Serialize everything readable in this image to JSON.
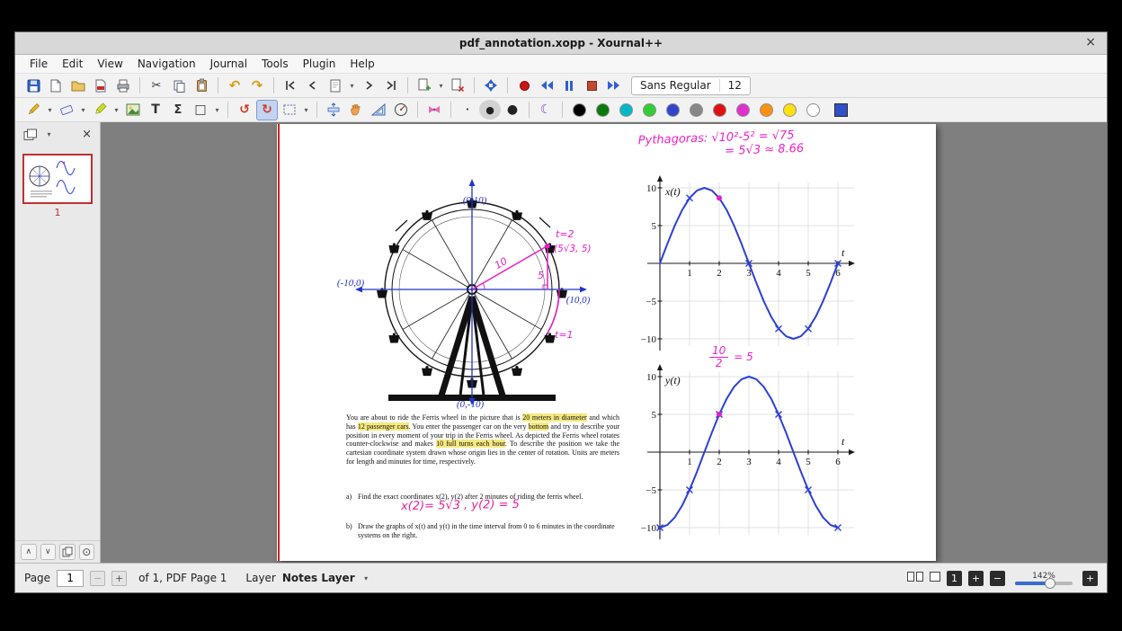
{
  "window": {
    "title": "pdf_annotation.xopp - Xournal++",
    "close": "×"
  },
  "menubar": {
    "items": [
      "File",
      "Edit",
      "View",
      "Navigation",
      "Journal",
      "Tools",
      "Plugin",
      "Help"
    ]
  },
  "toolbar": {
    "font_name": "Sans Regular",
    "font_size": "12",
    "icons": {
      "cut": "✂",
      "undo": "↶",
      "redo": "↷",
      "chevron_down": "▾",
      "text_tool": "T",
      "math_tool": "Σ",
      "shape_tool": "□",
      "default_tool": "↺",
      "shape_recognizer": "↻",
      "moon": "☾",
      "dot_small": "•",
      "dot_medium": "●",
      "dot_large": "●"
    },
    "colors": [
      "#000000",
      "#0a7a0a",
      "#00b8c8",
      "#33cc33",
      "#3344cc",
      "#888888",
      "#e01010",
      "#e030d0",
      "#ff9010",
      "#ffe010",
      "#ffffff"
    ],
    "active_color": "#3050c8"
  },
  "sidebar": {
    "close": "×",
    "thumb_label": "1",
    "nav_up": "∧",
    "nav_down": "∨",
    "target": "⊙"
  },
  "statusbar": {
    "page_label": "Page",
    "page_value": "1",
    "minus": "−",
    "plus": "+",
    "of_text": "of 1, PDF Page 1",
    "layer_label": "Layer",
    "layer_value": "Notes Layer",
    "chevron": "▾",
    "fit_value": "1",
    "zoom_in": "+",
    "zoom_out": "−",
    "zoom_percent": "142%",
    "zoom_add": "+"
  },
  "document": {
    "pythagoras": {
      "line1": "Pythagoras: √10²-5² = √75",
      "line2": "= 5√3 ≈ 8.66"
    },
    "wheel": {
      "label_top": "(0,10)",
      "label_left": "(-10,0)",
      "label_right": "(10,0)",
      "label_bottom": "(0,-10)",
      "t2": "t=2",
      "point": "(5√3, 5)",
      "radius": "10",
      "height": "5",
      "t1": "t=1"
    },
    "paragraph": {
      "seg1": "You are about to ride the Ferris wheel in the picture that is ",
      "hl1": "20 meters in diameter",
      "seg2": " and which has ",
      "hl2": "12 passenger cars",
      "seg3": ".  You enter the passenger car on the very ",
      "hl3": "bottom",
      "seg4": " and try to describe your position in every moment of your trip in the Ferris wheel. As depicted the Ferris wheel rotates counter-clockwise and makes ",
      "hl4": "10 full turns each hour",
      "seg5": ". To describe the position we take the cartesian coordinate system drawn whose origin lies in the center of rotation. Units are meters for length and minutes for time, respectively."
    },
    "item_a_label": "a)",
    "item_a_text": "Find the exact coordinates x(2), y(2) after 2 minutes of riding the ferris wheel.",
    "answer": "x(2)= 5√3 , y(2) = 5",
    "item_b_label": "b)",
    "item_b_text": "Draw the graphs of x(t) and y(t) in the time interval from 0 to 6 minutes in the coordinate systems on the right.",
    "fraction": {
      "num": "10",
      "den": "2",
      "result": "= 5"
    }
  },
  "charts": {
    "ticks_x": [
      "1",
      "2",
      "3",
      "4",
      "5",
      "6"
    ],
    "ticks_y": [
      "10",
      "5",
      "−5",
      "−10"
    ],
    "t_label": "t",
    "graph1_label": "x(t)",
    "graph2_label": "y(t)"
  },
  "chart_data": [
    {
      "type": "line",
      "title": "x(t)",
      "xlabel": "t",
      "ylabel": "x(t)",
      "xlim": [
        0,
        6.5
      ],
      "ylim": [
        -10,
        10
      ],
      "grid": true,
      "line_color": "#2b3fd4",
      "x": [
        0,
        0.5,
        1,
        1.5,
        2,
        2.5,
        3,
        3.5,
        4,
        4.5,
        5,
        5.5,
        6
      ],
      "values": [
        0,
        5,
        8.66,
        10,
        8.66,
        5,
        0,
        -5,
        -8.66,
        -10,
        -8.66,
        -5,
        0
      ],
      "cross_marks_t": [
        1,
        3,
        4,
        5,
        6
      ],
      "highlight_point": {
        "t": 2,
        "value": 8.66,
        "color": "#e020c8"
      }
    },
    {
      "type": "line",
      "title": "y(t)",
      "xlabel": "t",
      "ylabel": "y(t)",
      "xlim": [
        0,
        6.5
      ],
      "ylim": [
        -10,
        10
      ],
      "grid": true,
      "line_color": "#2b3fd4",
      "x": [
        0,
        0.5,
        1,
        1.5,
        2,
        2.5,
        3,
        3.5,
        4,
        4.5,
        5,
        5.5,
        6
      ],
      "values": [
        -10,
        -8.66,
        -5,
        0,
        5,
        8.66,
        10,
        8.66,
        5,
        0,
        -5,
        -8.66,
        -10
      ],
      "cross_marks_t": [
        0,
        1,
        2,
        4,
        5,
        6
      ],
      "highlight_point": {
        "t": 2,
        "value": 5,
        "color": "#e020c8"
      }
    }
  ]
}
